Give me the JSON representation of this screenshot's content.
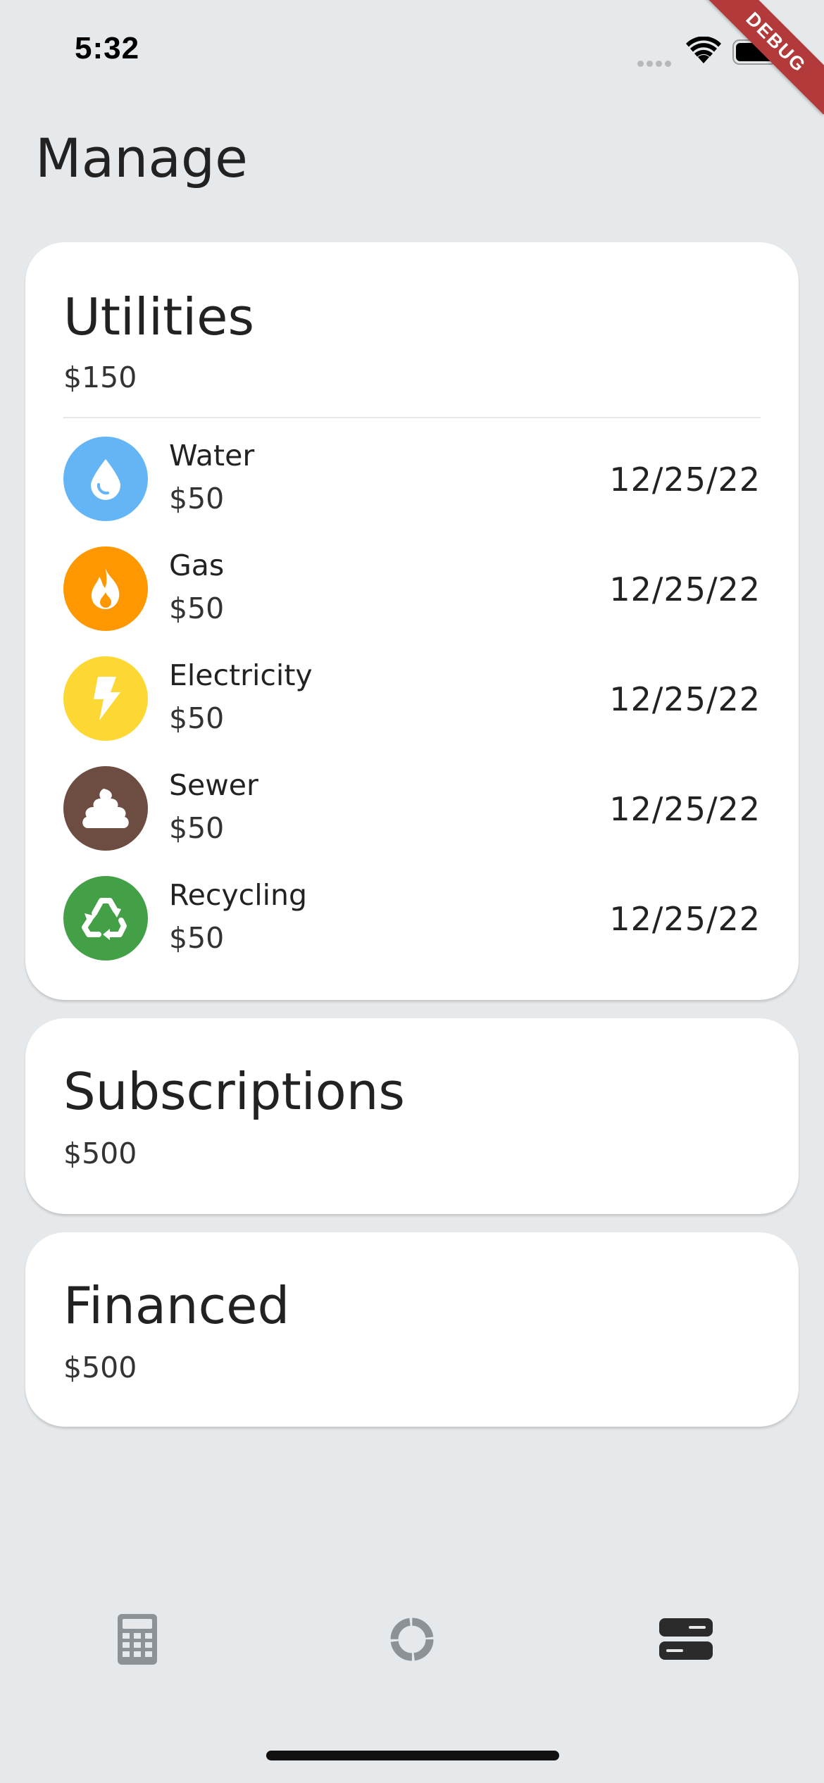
{
  "status_bar": {
    "time": "5:32"
  },
  "debug_banner": "DEBUG",
  "page": {
    "title": "Manage"
  },
  "utilities": {
    "title": "Utilities",
    "total": "$150",
    "items": [
      {
        "name": "Water",
        "amount": "$50",
        "date": "12/25/22",
        "icon": "water-drop-icon",
        "color": "#64B5F6"
      },
      {
        "name": "Gas",
        "amount": "$50",
        "date": "12/25/22",
        "icon": "flame-icon",
        "color": "#FF9800"
      },
      {
        "name": "Electricity",
        "amount": "$50",
        "date": "12/25/22",
        "icon": "lightning-bolt-icon",
        "color": "#FDD835"
      },
      {
        "name": "Sewer",
        "amount": "$50",
        "date": "12/25/22",
        "icon": "poop-icon",
        "color": "#6D4C41"
      },
      {
        "name": "Recycling",
        "amount": "$50",
        "date": "12/25/22",
        "icon": "recycle-icon",
        "color": "#43A047"
      }
    ]
  },
  "subscriptions": {
    "title": "Subscriptions",
    "total": "$500"
  },
  "financed": {
    "title": "Financed",
    "total": "$500"
  },
  "bottom_nav": {
    "items": [
      {
        "icon": "calculator-icon",
        "active": false
      },
      {
        "icon": "donut-chart-icon",
        "active": false
      },
      {
        "icon": "list-view-icon",
        "active": true
      }
    ]
  }
}
